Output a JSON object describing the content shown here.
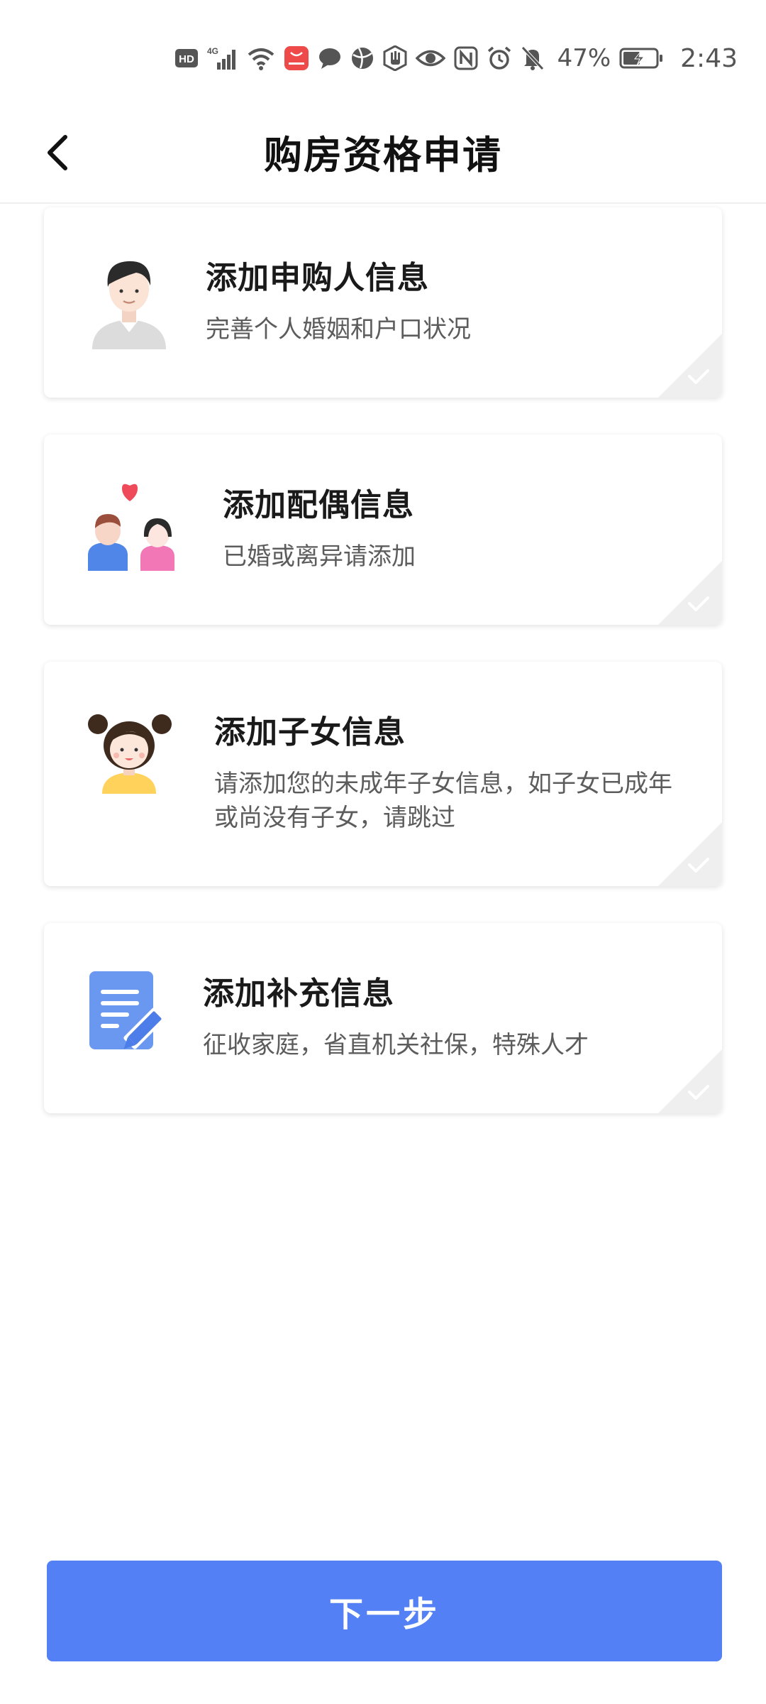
{
  "status_bar": {
    "hd_label": "HD",
    "network_label": "4G",
    "battery_percent": "47%",
    "time": "2:43",
    "icons": [
      "hd-icon",
      "signal-icon",
      "wifi-icon",
      "huawei-app-icon",
      "chat-icon",
      "ball-icon",
      "hand-icon",
      "eye-icon",
      "nfc-icon",
      "alarm-icon",
      "mute-icon",
      "battery-icon"
    ]
  },
  "header": {
    "title": "购房资格申请",
    "back_icon": "chevron-left-icon"
  },
  "cards": [
    {
      "title": "添加申购人信息",
      "description": "完善个人婚姻和户口状况",
      "icon": "applicant-man-icon",
      "status_icon": "check-icon"
    },
    {
      "title": "添加配偶信息",
      "description": "已婚或离异请添加",
      "icon": "couple-heart-icon",
      "status_icon": "check-icon"
    },
    {
      "title": "添加子女信息",
      "description_line1": "请添加您的未成年子女信息，如子女已成年",
      "description_line2": "或尚没有子女，请跳过",
      "icon": "child-girl-icon",
      "status_icon": "check-icon"
    },
    {
      "title": "添加补充信息",
      "description": "征收家庭，省直机关社保，特殊人才",
      "icon": "document-edit-icon",
      "status_icon": "check-icon"
    }
  ],
  "next_button": {
    "label": "下一步"
  },
  "colors": {
    "primary": "#5480f5",
    "card_shadow": "#e6e6e6",
    "title_text": "#1a1a1a",
    "desc_text": "#5c5c5c"
  }
}
